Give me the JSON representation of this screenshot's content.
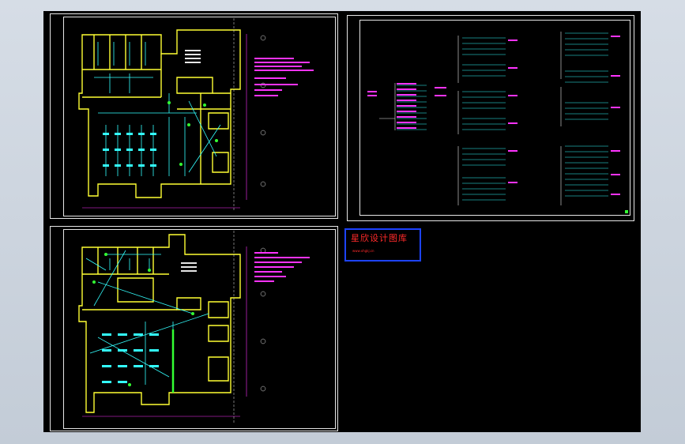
{
  "watermark": {
    "title": "星欣设计图库",
    "url": "www.xhgkj.cn"
  },
  "colors": {
    "canvas": "#000000",
    "sheet_border": "#e6e6e6",
    "wall": "#ffff33",
    "wiring": "#33ffff",
    "text": "#ff33ff",
    "green": "#33ff33",
    "watermark_border": "#1d43ff",
    "watermark_text": "#ff2a2a"
  },
  "sheets": [
    {
      "name": "lighting-plan"
    },
    {
      "name": "distribution-diagram"
    },
    {
      "name": "power-plan"
    }
  ]
}
